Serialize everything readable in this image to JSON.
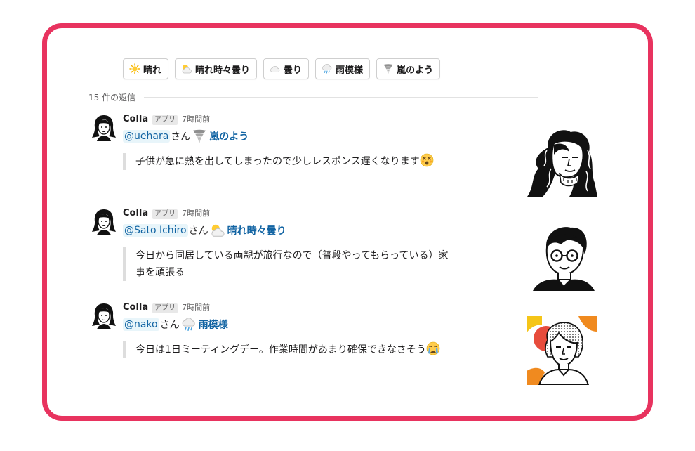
{
  "weather_buttons": [
    {
      "label": "晴れ",
      "icon": "sun-icon"
    },
    {
      "label": "晴れ時々曇り",
      "icon": "sun-behind-cloud-icon"
    },
    {
      "label": "曇り",
      "icon": "cloud-icon"
    },
    {
      "label": "雨模様",
      "icon": "rain-cloud-icon"
    },
    {
      "label": "嵐のよう",
      "icon": "tornado-icon"
    }
  ],
  "replies_label": "15 件の返信",
  "messages": [
    {
      "author": "Colla",
      "badge": "アプリ",
      "time": "7時間前",
      "mention": "@uehara",
      "honorific": "さん",
      "status": "嵐のよう",
      "status_icon": "tornado-icon",
      "text": "子供が急に熱を出してしまったので少しレスポンス遅くなります",
      "emoji": "dizzy-face-emoji"
    },
    {
      "author": "Colla",
      "badge": "アプリ",
      "time": "7時間前",
      "mention": "@Sato Ichiro",
      "honorific": "さん",
      "status": "晴れ時々曇り",
      "status_icon": "sun-behind-cloud-icon",
      "text_line1": "今日から同居している両親が旅行なので（普段やってもらっている）家",
      "text_line2": "事を頑張る"
    },
    {
      "author": "Colla",
      "badge": "アプリ",
      "time": "7時間前",
      "mention": "@nako",
      "honorific": "さん",
      "status": "雨模様",
      "status_icon": "rain-cloud-icon",
      "text": "今日は1日ミーティングデー。作業時間があまり確保できなさそう",
      "emoji": "crying-face-emoji"
    }
  ],
  "colors": {
    "frame": "#e8335f",
    "link": "#1264a3",
    "mention_bg": "#e8f5fa"
  }
}
